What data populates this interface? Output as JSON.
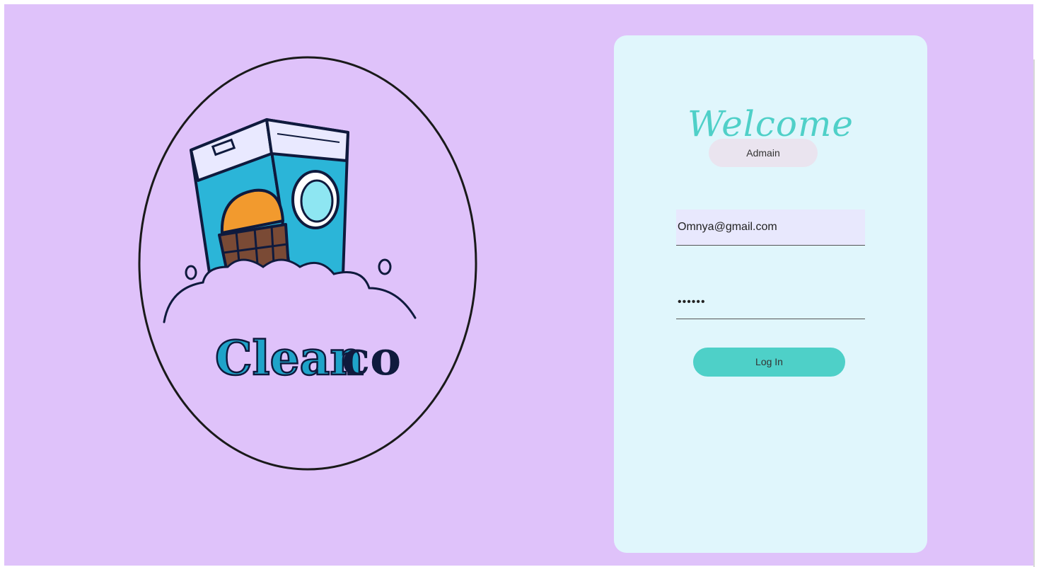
{
  "logo": {
    "text_part1": "Clean",
    "text_part2": "co",
    "icon": "washing-machine-icon",
    "colors": {
      "ring": "#1a1a1a",
      "machine": "#2bb5d8",
      "machine_light": "#e9e9ff",
      "basket": "#7a4a35",
      "laundry": "#f29a2e",
      "text_primary": "#1fa3c9",
      "text_secondary": "#0f1a3d"
    }
  },
  "login_card": {
    "heading": "Welcome",
    "role_label": "Admain",
    "email_value": "Omnya@gmail.com",
    "password_value": "••••••",
    "submit_label": "Log In"
  },
  "colors": {
    "page_background": "#dfc2fa",
    "card_background": "#e0f6fc",
    "accent": "#4ed0c8",
    "input_fill": "#e8e8fd",
    "pill_background": "#eae4ef"
  }
}
